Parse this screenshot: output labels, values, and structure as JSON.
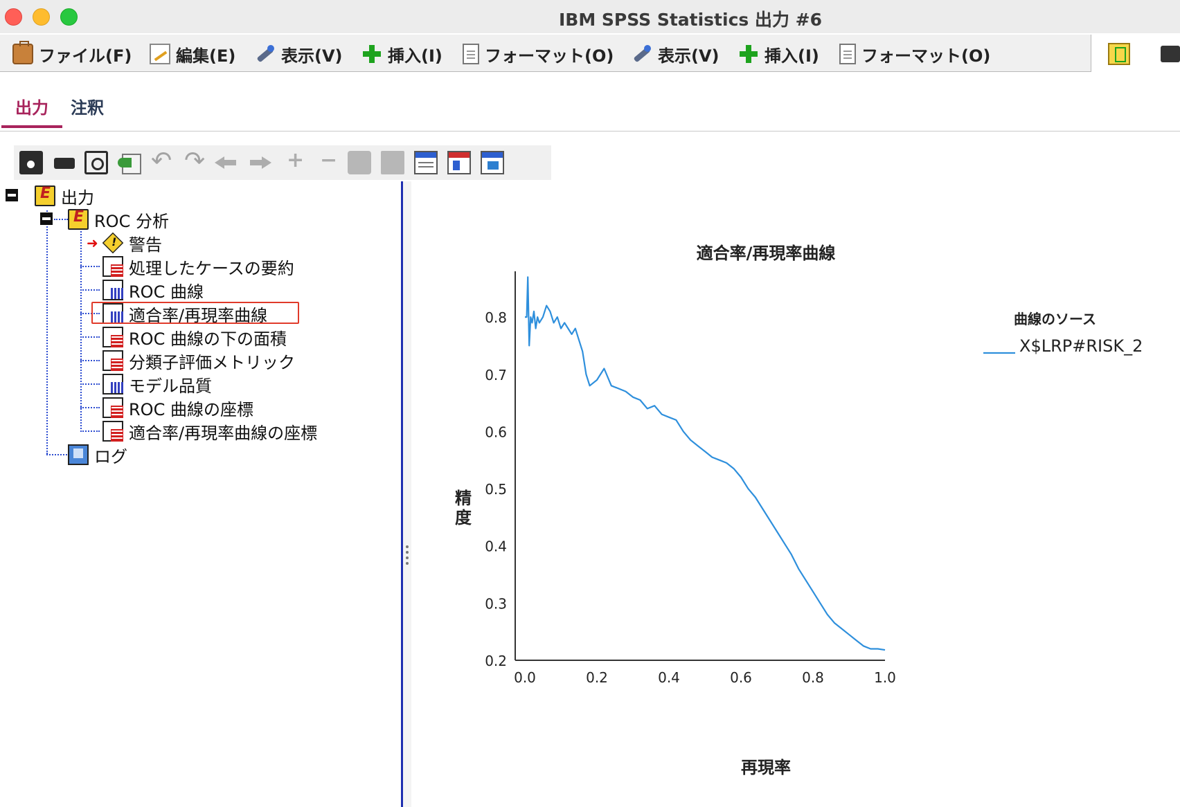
{
  "window": {
    "title": "IBM SPSS Statistics 出力 #6"
  },
  "menubar": {
    "items": [
      {
        "label": "ファイル(F)",
        "icon": "briefcase-icon"
      },
      {
        "label": "編集(E)",
        "icon": "edit-document-icon"
      },
      {
        "label": "表示(V)",
        "icon": "flashlight-icon"
      },
      {
        "label": "挿入(I)",
        "icon": "green-plus-icon"
      },
      {
        "label": "フォーマット(O)",
        "icon": "page-icon"
      },
      {
        "label": "表示(V)",
        "icon": "flashlight-icon"
      },
      {
        "label": "挿入(I)",
        "icon": "green-plus-icon"
      },
      {
        "label": "フォーマット(O)",
        "icon": "page-icon"
      }
    ]
  },
  "tabs": [
    {
      "label": "出力",
      "active": true
    },
    {
      "label": "注釈",
      "active": false
    }
  ],
  "toolbar": {
    "icons": [
      "save-icon",
      "print-icon",
      "print-preview-icon",
      "export-icon",
      "undo-icon",
      "redo-icon",
      "back-arrow-icon",
      "forward-arrow-icon",
      "expand-icon",
      "collapse-icon",
      "show-icon",
      "hide-icon",
      "designate-window-icon",
      "insert-heading-icon",
      "insert-title-icon"
    ]
  },
  "tree": {
    "root": "出力",
    "analysis": "ROC 分析",
    "items": [
      {
        "label": "警告",
        "icon": "warning-icon",
        "arrow": true
      },
      {
        "label": "処理したケースの要約",
        "icon": "table-icon"
      },
      {
        "label": "ROC 曲線",
        "icon": "chart-icon"
      },
      {
        "label": "適合率/再現率曲線",
        "icon": "chart-icon",
        "selected": true
      },
      {
        "label": "ROC 曲線の下の面積",
        "icon": "table-icon"
      },
      {
        "label": "分類子評価メトリック",
        "icon": "table-icon"
      },
      {
        "label": "モデル品質",
        "icon": "chart-icon"
      },
      {
        "label": "ROC 曲線の座標",
        "icon": "table-icon"
      },
      {
        "label": "適合率/再現率曲線の座標",
        "icon": "table-icon"
      }
    ],
    "log": "ログ"
  },
  "chart_data": {
    "type": "line",
    "title": "適合率/再現率曲線",
    "xlabel": "再現率",
    "ylabel": "精度",
    "xlim": [
      0.0,
      1.0
    ],
    "ylim": [
      0.2,
      0.88
    ],
    "xticks": [
      "0.0",
      "0.2",
      "0.4",
      "0.6",
      "0.8",
      "1.0"
    ],
    "yticks": [
      "0.2",
      "0.3",
      "0.4",
      "0.5",
      "0.6",
      "0.7",
      "0.8"
    ],
    "legend": {
      "title": "曲線のソース",
      "position": "right"
    },
    "series": [
      {
        "name": "X$LRP#RISK_2",
        "color": "#2e8fdc",
        "x": [
          0.0,
          0.005,
          0.008,
          0.012,
          0.016,
          0.02,
          0.025,
          0.03,
          0.035,
          0.04,
          0.05,
          0.06,
          0.07,
          0.08,
          0.09,
          0.1,
          0.11,
          0.12,
          0.13,
          0.14,
          0.15,
          0.16,
          0.17,
          0.18,
          0.2,
          0.22,
          0.24,
          0.26,
          0.28,
          0.3,
          0.32,
          0.34,
          0.36,
          0.38,
          0.4,
          0.42,
          0.44,
          0.46,
          0.48,
          0.5,
          0.52,
          0.54,
          0.56,
          0.58,
          0.6,
          0.62,
          0.64,
          0.66,
          0.68,
          0.7,
          0.72,
          0.74,
          0.76,
          0.78,
          0.8,
          0.82,
          0.84,
          0.86,
          0.88,
          0.9,
          0.92,
          0.94,
          0.96,
          0.98,
          1.0
        ],
        "y": [
          0.8,
          0.8,
          0.87,
          0.75,
          0.8,
          0.79,
          0.81,
          0.78,
          0.8,
          0.79,
          0.8,
          0.82,
          0.81,
          0.79,
          0.8,
          0.78,
          0.79,
          0.78,
          0.77,
          0.78,
          0.76,
          0.74,
          0.7,
          0.68,
          0.69,
          0.71,
          0.68,
          0.675,
          0.67,
          0.66,
          0.655,
          0.64,
          0.645,
          0.63,
          0.625,
          0.62,
          0.6,
          0.585,
          0.575,
          0.565,
          0.555,
          0.55,
          0.545,
          0.535,
          0.52,
          0.5,
          0.485,
          0.465,
          0.445,
          0.425,
          0.405,
          0.385,
          0.36,
          0.34,
          0.32,
          0.3,
          0.28,
          0.265,
          0.255,
          0.245,
          0.235,
          0.225,
          0.22,
          0.22,
          0.218
        ]
      }
    ]
  }
}
